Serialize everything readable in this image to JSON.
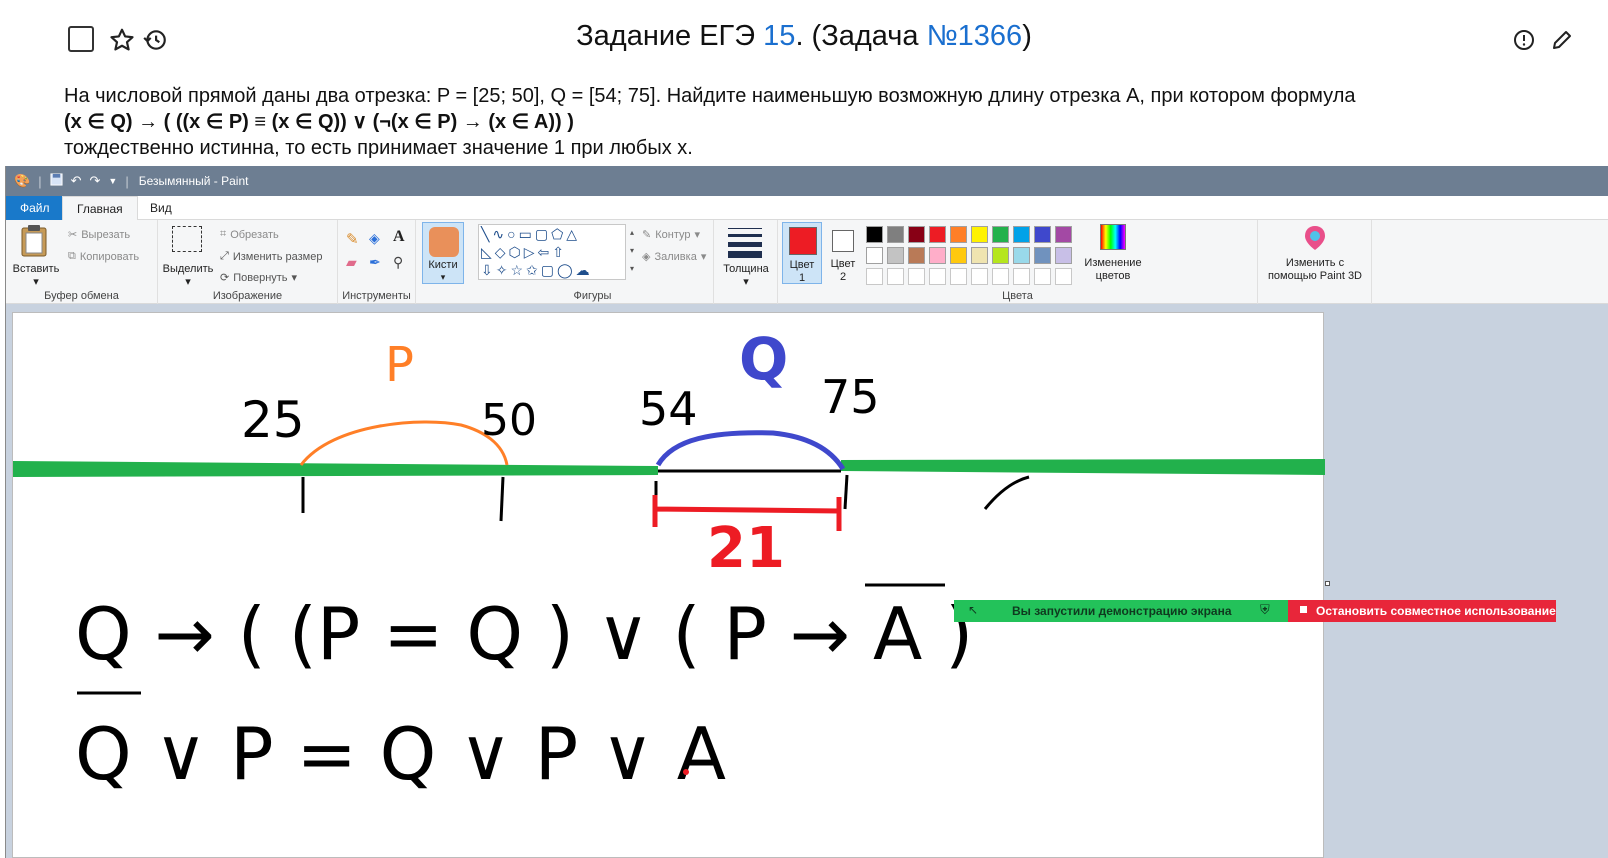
{
  "header": {
    "title_prefix": "Задание ЕГЭ ",
    "task_number": "15",
    "title_middle": ". (Задача ",
    "problem_id": "№1366",
    "title_suffix": ")"
  },
  "problem": {
    "line1": "На числовой прямой даны два отрезка: P = [25; 50], Q = [54; 75]. Найдите наименьшую возможную длину отрезка A, при котором формула",
    "formula": "(x ∈ Q) → ( ((x ∈ P) ≡ (x ∈ Q)) ∨ (¬(x ∈ P) → (x ∈ A)) )",
    "line3": "тождественно истинна, то есть принимает значение 1 при любых x."
  },
  "paint": {
    "window_title": "Безымянный - Paint",
    "tabs": {
      "file": "Файл",
      "home": "Главная",
      "view": "Вид"
    },
    "clipboard": {
      "paste": "Вставить",
      "cut": "Вырезать",
      "copy": "Копировать",
      "label": "Буфер обмена"
    },
    "image": {
      "select": "Выделить",
      "crop": "Обрезать",
      "resize": "Изменить размер",
      "rotate": "Повернуть",
      "label": "Изображение"
    },
    "tools": {
      "label": "Инструменты",
      "brushes": "Кисти"
    },
    "shapes": {
      "outline": "Контур",
      "fill": "Заливка",
      "label": "Фигуры"
    },
    "size": {
      "label": "Толщина"
    },
    "colors": {
      "color1_line1": "Цвет",
      "color1_line2": "1",
      "color2_line1": "Цвет",
      "color2_line2": "2",
      "edit_line1": "Изменение",
      "edit_line2": "цветов",
      "paint3d_line1": "Изменить с",
      "paint3d_line2": "помощью Paint 3D",
      "label": "Цвета",
      "color1": "#ed1c24",
      "color2": "#ffffff",
      "palette_row1": [
        "#000000",
        "#7f7f7f",
        "#880015",
        "#ed1c24",
        "#ff7f27",
        "#fff200",
        "#22b14c",
        "#00a2e8",
        "#3f48cc",
        "#a349a4"
      ],
      "palette_row2": [
        "#ffffff",
        "#c3c3c3",
        "#b97a57",
        "#ffaec9",
        "#ffc90e",
        "#efe4b0",
        "#b5e61d",
        "#99d9ea",
        "#7092be",
        "#c8bfe7"
      ]
    }
  },
  "drawing": {
    "label_p": "P",
    "label_q": "Q",
    "n25": "25",
    "n50": "50",
    "n54": "54",
    "n75": "75",
    "len": "21",
    "line1": "Q → ( (P = Q ) ∨ ( P → A )",
    "line2": "Q ∨ P = Q ∨ P ∨ A"
  },
  "sharing": {
    "running": "Вы запустили демонстрацию экрана",
    "stop": "Остановить совместное использование"
  }
}
